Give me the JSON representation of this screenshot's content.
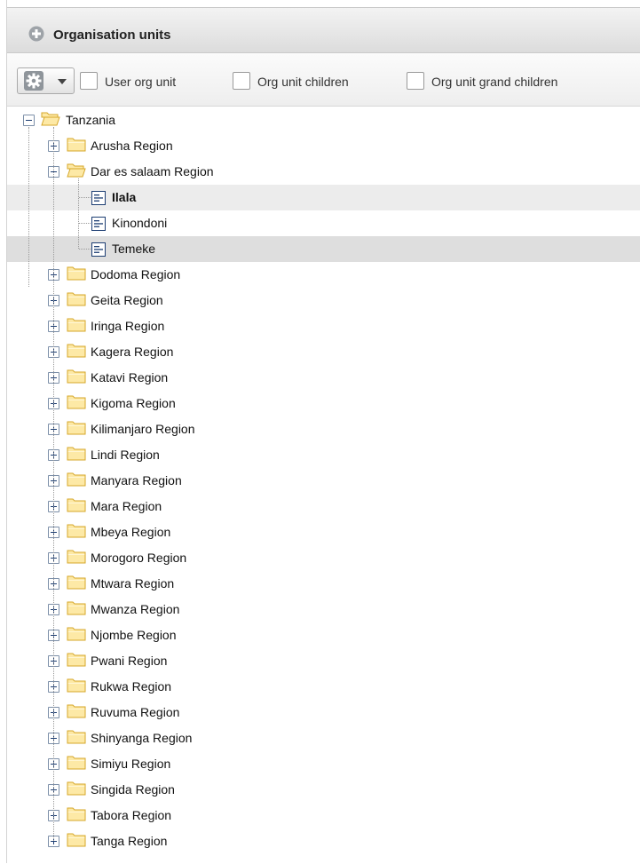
{
  "panel": {
    "title": "Organisation units"
  },
  "toolbar": {
    "checkboxes": [
      {
        "label": "User org unit",
        "checked": false
      },
      {
        "label": "Org unit children",
        "checked": false
      },
      {
        "label": "Org unit grand children",
        "checked": false
      }
    ]
  },
  "tree": {
    "root": {
      "label": "Tanzania",
      "expanded": true
    },
    "regions": [
      {
        "label": "Arusha Region",
        "expanded": false
      },
      {
        "label": "Dar es salaam Region",
        "expanded": true,
        "children": [
          {
            "label": "Ilala",
            "state": "selected"
          },
          {
            "label": "Kinondoni",
            "state": "normal"
          },
          {
            "label": "Temeke",
            "state": "hover"
          }
        ]
      },
      {
        "label": "Dodoma Region",
        "expanded": false
      },
      {
        "label": "Geita Region",
        "expanded": false
      },
      {
        "label": "Iringa Region",
        "expanded": false
      },
      {
        "label": "Kagera Region",
        "expanded": false
      },
      {
        "label": "Katavi Region",
        "expanded": false
      },
      {
        "label": "Kigoma Region",
        "expanded": false
      },
      {
        "label": "Kilimanjaro Region",
        "expanded": false
      },
      {
        "label": "Lindi Region",
        "expanded": false
      },
      {
        "label": "Manyara Region",
        "expanded": false
      },
      {
        "label": "Mara Region",
        "expanded": false
      },
      {
        "label": "Mbeya Region",
        "expanded": false
      },
      {
        "label": "Morogoro Region",
        "expanded": false
      },
      {
        "label": "Mtwara Region",
        "expanded": false
      },
      {
        "label": "Mwanza Region",
        "expanded": false
      },
      {
        "label": "Njombe Region",
        "expanded": false
      },
      {
        "label": "Pwani Region",
        "expanded": false
      },
      {
        "label": "Rukwa Region",
        "expanded": false
      },
      {
        "label": "Ruvuma Region",
        "expanded": false
      },
      {
        "label": "Shinyanga Region",
        "expanded": false
      },
      {
        "label": "Simiyu Region",
        "expanded": false
      },
      {
        "label": "Singida Region",
        "expanded": false
      },
      {
        "label": "Tabora Region",
        "expanded": false
      },
      {
        "label": "Tanga Region",
        "expanded": false
      }
    ]
  },
  "colors": {
    "folder_fill": "#fde9a6",
    "folder_stroke": "#d6a72a",
    "toggle_border": "#7c8fa8",
    "selected_row": "#ececec",
    "hover_row": "#dedede"
  }
}
